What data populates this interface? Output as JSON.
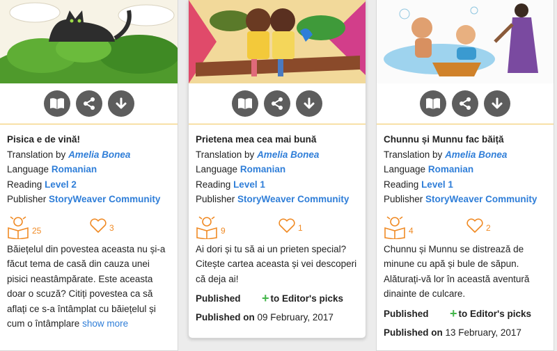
{
  "cards": [
    {
      "title": "Pisica e de vină!",
      "translation_label": "Translation by",
      "translator": "Amelia Bonea",
      "language_label": "Language",
      "language": "Romanian",
      "reading_label": "Reading",
      "level": "Level 2",
      "publisher_label": "Publisher",
      "publisher": "StoryWeaver Community",
      "reads": "25",
      "likes": "3",
      "description": "Băiețelul din povestea aceasta nu și-a făcut tema de casă din cauza unei pisici neastâmpărate. Este aceasta doar o scuză? Citiți povestea ca să aflați ce s-a întâmplat cu băiețelul și cum o întâmplare",
      "show_more": "show more"
    },
    {
      "title": "Prietena mea cea mai bună",
      "translation_label": "Translation by",
      "translator": "Amelia Bonea",
      "language_label": "Language",
      "language": "Romanian",
      "reading_label": "Reading",
      "level": "Level 1",
      "publisher_label": "Publisher",
      "publisher": "StoryWeaver Community",
      "reads": "9",
      "likes": "1",
      "description": "Ai dori și tu să ai un prieten special? Citește cartea aceasta și vei descoperi că deja ai!",
      "published_label": "Published",
      "editors_picks": "to Editor's picks",
      "published_on_label": "Published on",
      "published_date": "09 February, 2017"
    },
    {
      "title": "Chunnu și Munnu fac băiță",
      "translation_label": "Translation by",
      "translator": "Amelia Bonea",
      "language_label": "Language",
      "language": "Romanian",
      "reading_label": "Reading",
      "level": "Level 1",
      "publisher_label": "Publisher",
      "publisher": "StoryWeaver Community",
      "reads": "4",
      "likes": "2",
      "description": "Chunnu și Munnu se distrează de minune cu apă și bule de săpun. Alăturați-vă lor în această aventură dinainte de culcare.",
      "published_label": "Published",
      "editors_picks": "to Editor's picks",
      "published_on_label": "Published on",
      "published_date": "13 February, 2017"
    }
  ],
  "icons": [
    "read-book-icon",
    "share-icon",
    "download-icon",
    "reader-kid-icon",
    "heart-icon",
    "plus-icon"
  ],
  "colors": {
    "link": "#2f7ed8",
    "accent_orange": "#f08a24",
    "action_bg": "#5d5d5d",
    "divider": "#f1c65a",
    "plus_green": "#43b54a"
  }
}
